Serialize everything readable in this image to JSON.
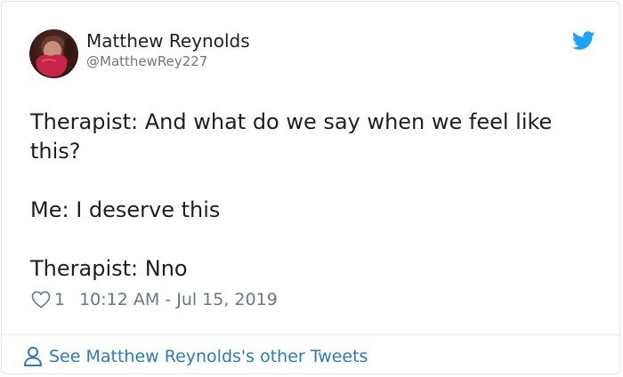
{
  "author": {
    "display_name": "Matthew Reynolds",
    "handle": "@MatthewRey227",
    "avatar_icon": "profile-photo"
  },
  "brand": {
    "icon": "twitter-bird-icon",
    "color": "#1da1f2"
  },
  "tweet": {
    "lines": [
      "Therapist: And what do we say when we feel like this?",
      "Me: I deserve this",
      "Therapist: Nno"
    ]
  },
  "meta": {
    "like_icon": "heart-icon",
    "like_count": "1",
    "timestamp": "10:12 AM - Jul 15, 2019"
  },
  "footer": {
    "icon": "person-icon",
    "link_text": "See Matthew Reynolds's other Tweets",
    "link_color": "#2b7bb9"
  }
}
